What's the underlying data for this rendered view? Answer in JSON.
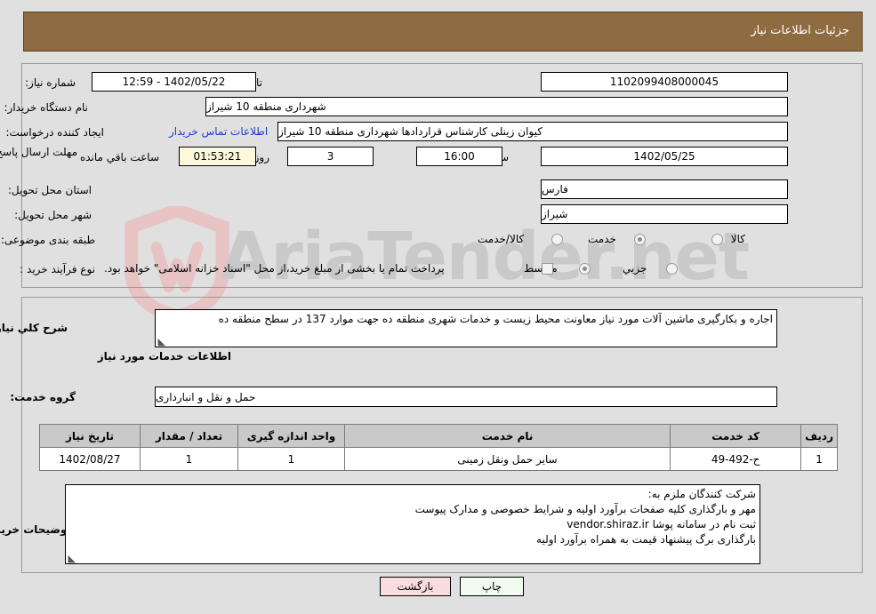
{
  "header": {
    "title": "جزئیات اطلاعات نیاز"
  },
  "form": {
    "need_number_label": "شماره نیاز:",
    "need_number_value": "1102099408000045",
    "announce_datetime_label": "تاریخ و ساعت اعلان عمومی:",
    "announce_datetime_value": "1402/05/22 - 12:59",
    "buyer_org_label": "نام دستگاه خریدار:",
    "buyer_org_value": "شهرداری منطقه 10 شیراز",
    "creator_label": "ایجاد کننده درخواست:",
    "creator_value": "کیوان زینلی کارشناس قراردادها شهرداری منطقه 10 شیراز",
    "contact_link": "اطلاعات تماس خریدار",
    "deadline_label": "مهلت ارسال پاسخ: تا تاریخ:",
    "deadline_date_value": "1402/05/25",
    "hour_label": "ساعت",
    "deadline_time_value": "16:00",
    "days_value": "3",
    "days_label": "روز و",
    "remaining_time_value": "01:53:21",
    "remaining_label": "ساعت باقي مانده",
    "province_label": "استان محل تحویل:",
    "province_value": "فارس",
    "city_label": "شهر محل تحویل:",
    "city_value": "شیراز",
    "category_label": "طبقه بندی موضوعی:",
    "category_options": [
      {
        "label": "کالا",
        "selected": false
      },
      {
        "label": "خدمت",
        "selected": true
      },
      {
        "label": "کالا/خدمت",
        "selected": false
      }
    ],
    "process_label": "نوع فرآیند خرید :",
    "process_options": [
      {
        "label": "جزیي",
        "selected": false
      },
      {
        "label": "متوسط",
        "selected": true
      }
    ],
    "treasury_checkbox_label": "پرداخت تمام یا بخشی از مبلغ خرید،از محل \"اسناد خزانه اسلامی\" خواهد بود.",
    "treasury_checked": false
  },
  "details": {
    "need_summary_label": "شرح کلي نیاز:",
    "need_summary_value": "اجاره و بکارگیری ماشین آلات مورد نیاز معاونت محیط زیست و خدمات شهری منطقه ده جهت موارد  137 در سطح منطقه ده",
    "services_section_title": "اطلاعات خدمات مورد نیاز",
    "service_group_label": "گروه خدمت:",
    "service_group_value": "حمل و نقل و انبارداری"
  },
  "table": {
    "columns": [
      "ردیف",
      "کد خدمت",
      "نام خدمت",
      "واحد اندازه گیری",
      "تعداد / مقدار",
      "تاریخ نیاز"
    ],
    "rows": [
      {
        "row": "1",
        "service_code": "ح-492-49",
        "service_name": "سایر حمل ونقل زمینی",
        "unit": "1",
        "quantity": "1",
        "need_date": "1402/08/27"
      }
    ]
  },
  "notes": {
    "label": "توضیحات خریدار:",
    "lines": [
      "شرکت کنندگان ملزم به:",
      "مهر و بارگذاری کلیه صفحات برآورد اولیه و شرایط خصوصی و مدارک پیوست",
      "ثبت نام در سامانه پوشا vendor.shiraz.ir",
      "بارگذاری برگ پیشنهاد قیمت به همراه برآورد اولیه"
    ]
  },
  "buttons": {
    "print": "چاپ",
    "back": "بازگشت"
  },
  "watermark": {
    "text": "AriaTender.net"
  },
  "colors": {
    "header_bar": "#8e6b40",
    "page_background": "#e0e0e0",
    "link": "#1b3ad0",
    "table_header": "#c9c9c9",
    "print_button": "#eefbee",
    "back_button": "#fbdcdc",
    "timer_field": "#fbf8dc"
  }
}
